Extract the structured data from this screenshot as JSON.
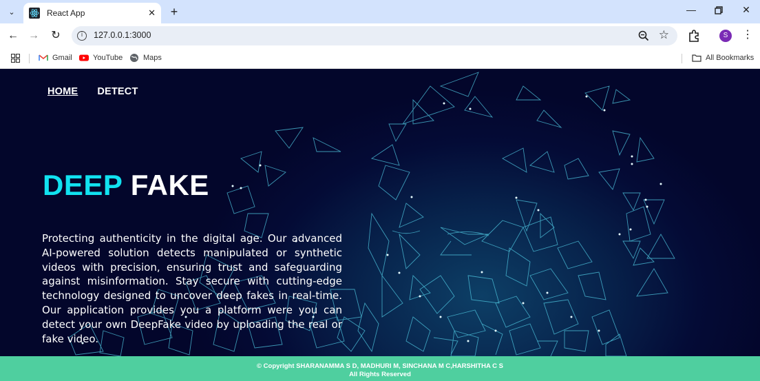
{
  "browser": {
    "tab_title": "React App",
    "url": "127.0.0.1:3000",
    "avatar_letter": "S",
    "bookmarks": [
      {
        "label": "Gmail",
        "icon": "gmail-icon"
      },
      {
        "label": "YouTube",
        "icon": "youtube-icon"
      },
      {
        "label": "Maps",
        "icon": "maps-icon"
      }
    ],
    "all_bookmarks": "All Bookmarks"
  },
  "nav": {
    "home": "HOME",
    "detect": "DETECT"
  },
  "hero": {
    "title_word1": "DEEP",
    "title_word2": "FAKE",
    "description": "Protecting authenticity in the digital age. Our advanced AI-powered solution detects manipulated or synthetic videos with precision, ensuring trust and safeguarding against misinformation. Stay secure with cutting-edge technology designed to uncover deep fakes in real-time. Our application provides you a platform were you can detect your own DeepFake video by uploading the real or fake video."
  },
  "footer": {
    "copyright": "© Copyright SHARANAMMA S D, MADHURI M, SINCHANA M C,HARSHITHA C S",
    "rights": "All Rights Reserved"
  },
  "colors": {
    "accent_cyan": "#11e2f0",
    "footer_green": "#4fcf9f",
    "page_bg": "#040b36"
  }
}
